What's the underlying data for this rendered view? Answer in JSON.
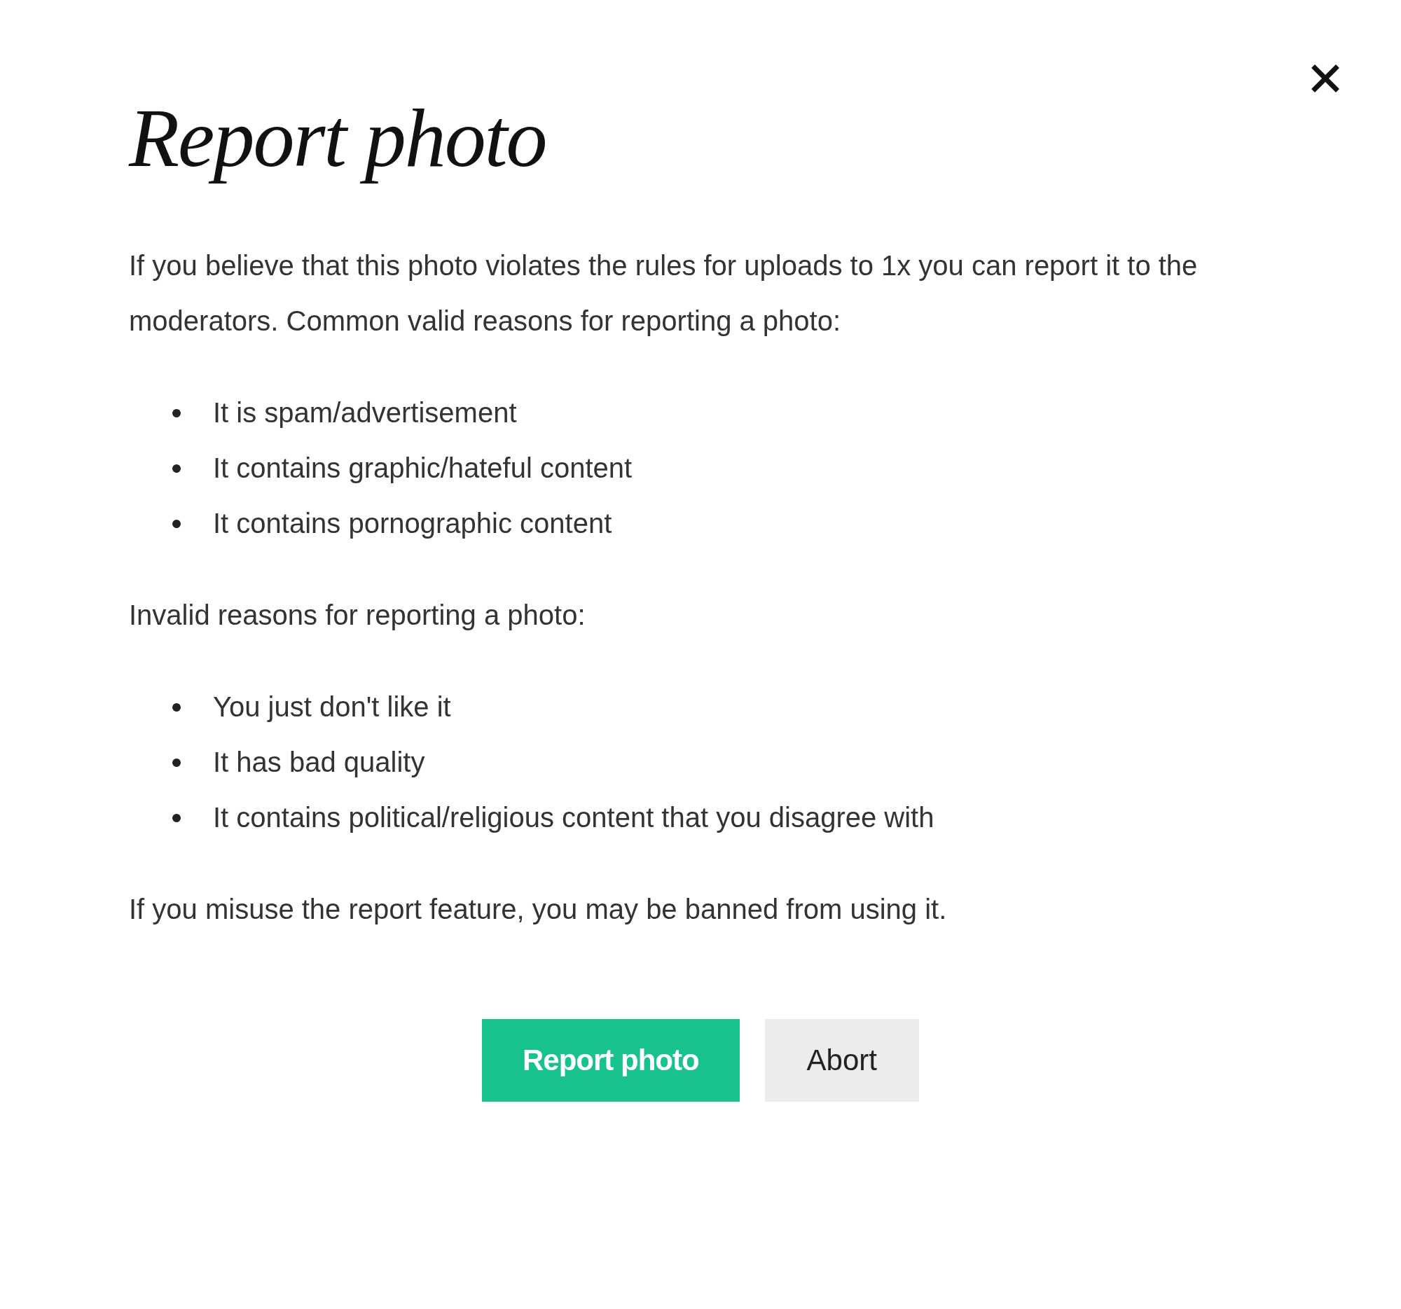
{
  "dialog": {
    "title": "Report photo",
    "intro": "If you believe that this photo violates the rules for uploads to 1x you can report it to the moderators. Common valid reasons for reporting a photo:",
    "valid_reasons": [
      "It is spam/advertisement",
      "It contains graphic/hateful content",
      "It contains pornographic content"
    ],
    "invalid_heading": "Invalid reasons for reporting a photo:",
    "invalid_reasons": [
      "You just don't like it",
      "It has bad quality",
      "It contains political/religious content that you disagree with"
    ],
    "warning": "If you misuse the report feature, you may be banned from using it.",
    "buttons": [
      {
        "label": "Report photo",
        "kind": "primary"
      },
      {
        "label": "Abort",
        "kind": "secondary"
      }
    ]
  }
}
